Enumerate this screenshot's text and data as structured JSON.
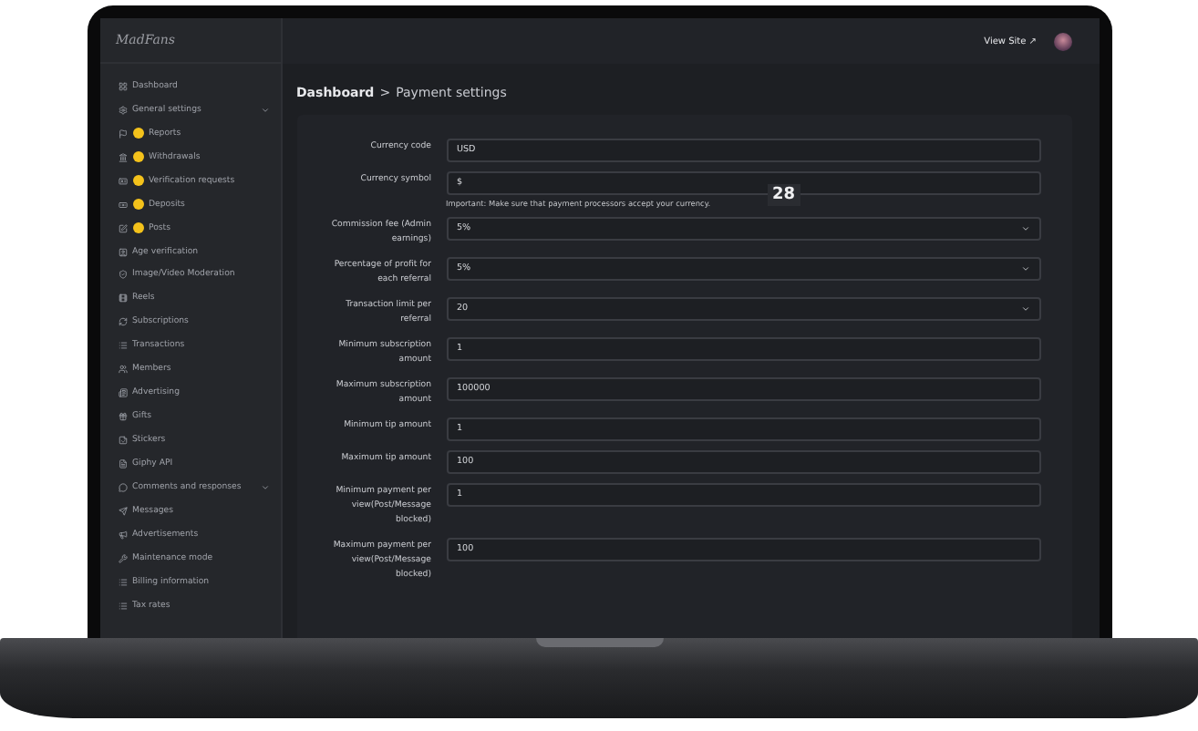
{
  "logo": "MadFans",
  "topbar": {
    "view_site": "View Site ↗"
  },
  "sidebar": {
    "items": [
      {
        "label": "Dashboard",
        "badge": false,
        "expandable": false
      },
      {
        "label": "General settings",
        "badge": false,
        "expandable": true
      },
      {
        "label": "Reports",
        "badge": true,
        "expandable": false
      },
      {
        "label": "Withdrawals",
        "badge": true,
        "expandable": false
      },
      {
        "label": "Verification requests",
        "badge": true,
        "expandable": false
      },
      {
        "label": "Deposits",
        "badge": true,
        "expandable": false
      },
      {
        "label": "Posts",
        "badge": true,
        "expandable": false
      },
      {
        "label": "Age verification",
        "badge": false,
        "expandable": false
      },
      {
        "label": "Image/Video Moderation",
        "badge": false,
        "expandable": false
      },
      {
        "label": "Reels",
        "badge": false,
        "expandable": false
      },
      {
        "label": "Subscriptions",
        "badge": false,
        "expandable": false
      },
      {
        "label": "Transactions",
        "badge": false,
        "expandable": false
      },
      {
        "label": "Members",
        "badge": false,
        "expandable": false
      },
      {
        "label": "Advertising",
        "badge": false,
        "expandable": false
      },
      {
        "label": "Gifts",
        "badge": false,
        "expandable": false
      },
      {
        "label": "Stickers",
        "badge": false,
        "expandable": false
      },
      {
        "label": "Giphy API",
        "badge": false,
        "expandable": false
      },
      {
        "label": "Comments and responses",
        "badge": false,
        "expandable": true
      },
      {
        "label": "Messages",
        "badge": false,
        "expandable": false
      },
      {
        "label": "Advertisements",
        "badge": false,
        "expandable": false
      },
      {
        "label": "Maintenance mode",
        "badge": false,
        "expandable": false
      },
      {
        "label": "Billing information",
        "badge": false,
        "expandable": false
      },
      {
        "label": "Tax rates",
        "badge": false,
        "expandable": false
      }
    ]
  },
  "breadcrumb": {
    "root": "Dashboard",
    "separator": ">",
    "current": "Payment settings"
  },
  "overlay_counter": "28",
  "form": {
    "fields": [
      {
        "kind": "input",
        "label": "Currency code",
        "value": "USD"
      },
      {
        "kind": "input",
        "label": "Currency symbol",
        "value": "$",
        "help": "Important: Make sure that payment processors accept your currency."
      },
      {
        "kind": "select",
        "label": "Commission fee (Admin earnings)",
        "value": "5%"
      },
      {
        "kind": "select",
        "label": "Percentage of profit for each referral",
        "value": "5%"
      },
      {
        "kind": "select",
        "label": "Transaction limit per referral",
        "value": "20"
      },
      {
        "kind": "input",
        "label": "Minimum subscription amount",
        "value": "1"
      },
      {
        "kind": "input",
        "label": "Maximum subscription amount",
        "value": "100000"
      },
      {
        "kind": "input",
        "label": "Minimum tip amount",
        "value": "1"
      },
      {
        "kind": "input",
        "label": "Maximum tip amount",
        "value": "100"
      },
      {
        "kind": "input",
        "label": "Minimum payment per view(Post/Message blocked)",
        "value": "1"
      },
      {
        "kind": "input",
        "label": "Maximum payment per view(Post/Message blocked)",
        "value": "100"
      }
    ]
  }
}
